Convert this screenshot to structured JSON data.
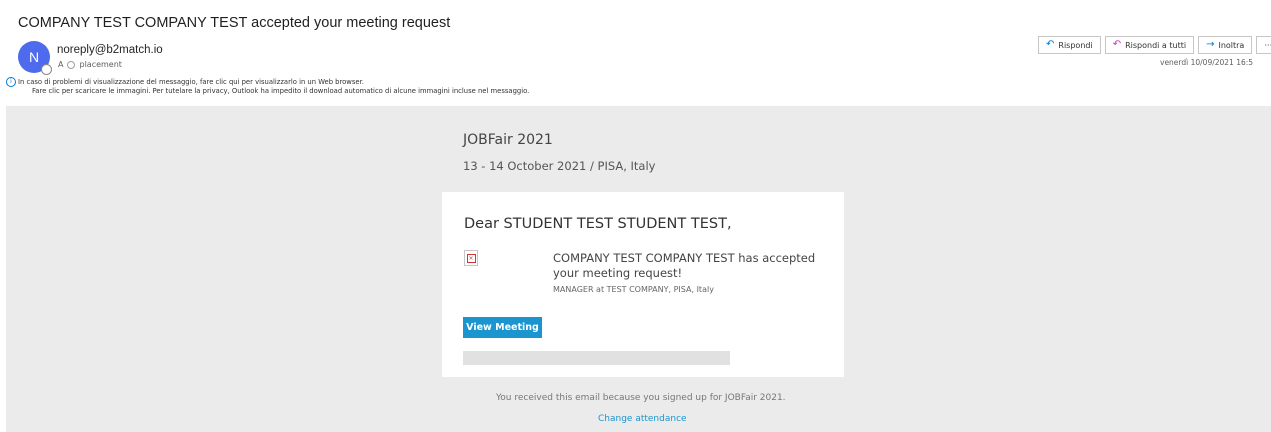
{
  "email": {
    "subject": "COMPANY TEST COMPANY TEST accepted your meeting request",
    "avatar_initial": "N",
    "sender": "noreply@b2match.io",
    "to_prefix": "A",
    "to_recipient": "placement",
    "info_line1": "In caso di problemi di visualizzazione del messaggio, fare clic qui per visualizzarlo in un Web browser.",
    "info_line2": "Fare clic per scaricare le immagini. Per tutelare la privacy, Outlook ha impedito il download automatico di alcune immagini incluse nel messaggio.",
    "date": "venerdì 10/09/2021 16:5"
  },
  "actions": {
    "reply": "Rispondi",
    "reply_all": "Rispondi a tutti",
    "forward": "Inoltra",
    "more": "···"
  },
  "body": {
    "event_title": "JOBFair 2021",
    "event_date": "13 - 14 October 2021 / PISA, Italy",
    "greeting": "Dear STUDENT TEST STUDENT TEST,",
    "accept_message": "COMPANY TEST COMPANY TEST has accepted your meeting request!",
    "role": "MANAGER at TEST COMPANY, PISA, Italy",
    "view_button": "View Meeting",
    "footer_note": "You received this email because you signed up for JOBFair 2021.",
    "change_link": "Change attendance"
  },
  "colors": {
    "avatar": "#4f6bed",
    "button": "#1b95d0",
    "link": "#1b95d0",
    "body_background": "#ebebeb"
  }
}
